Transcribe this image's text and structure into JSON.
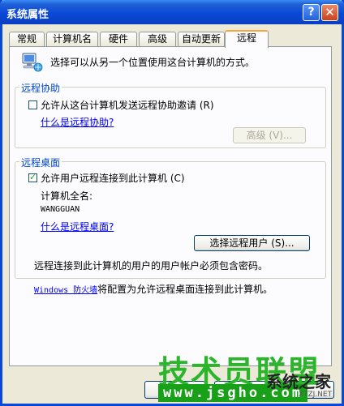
{
  "window": {
    "title": "系统属性",
    "help_glyph": "?",
    "close_glyph": "✕"
  },
  "tabs": [
    {
      "label": "常规"
    },
    {
      "label": "计算机名"
    },
    {
      "label": "硬件"
    },
    {
      "label": "高级"
    },
    {
      "label": "自动更新"
    },
    {
      "label": "远程",
      "active": true
    }
  ],
  "intro": {
    "text": "选择可以从另一个位置使用这台计算机的方式。",
    "icon": "computer-network-icon"
  },
  "remote_assistance": {
    "group_label": "远程协助",
    "checkbox_label": "允许从这台计算机发送远程协助邀请 (R)",
    "checked": false,
    "link": "什么是远程协助?",
    "advanced_button": "高级 (V)..."
  },
  "remote_desktop": {
    "group_label": "远程桌面",
    "checkbox_label": "允许用户远程连接到此计算机 (C)",
    "checked": true,
    "computer_name_label": "计算机全名:",
    "computer_name_value": "WANGGUAN",
    "link": "什么是远程桌面?",
    "select_users_button": "选择远程用户 (S)...",
    "password_note": "远程连接到此计算机的用户的用户帐户必须包含密码。",
    "firewall_link": "Windows 防火墙",
    "firewall_text": "将配置为允许远程桌面连接到此计算机。"
  },
  "watermark": {
    "logo_text": "技术员联盟",
    "url": "www.jsgho.com",
    "site_name": "系统之家",
    "site_domain": "XTZJ.NET"
  },
  "colors": {
    "title_bar": "#0a49d8",
    "dialog_bg": "#ece9d8",
    "panel_bg": "#fcfcfe",
    "group_label": "#0046d5",
    "active_tab_accent": "#f9a637",
    "link": "#0000ff",
    "watermark_green": "#2ab52a"
  }
}
